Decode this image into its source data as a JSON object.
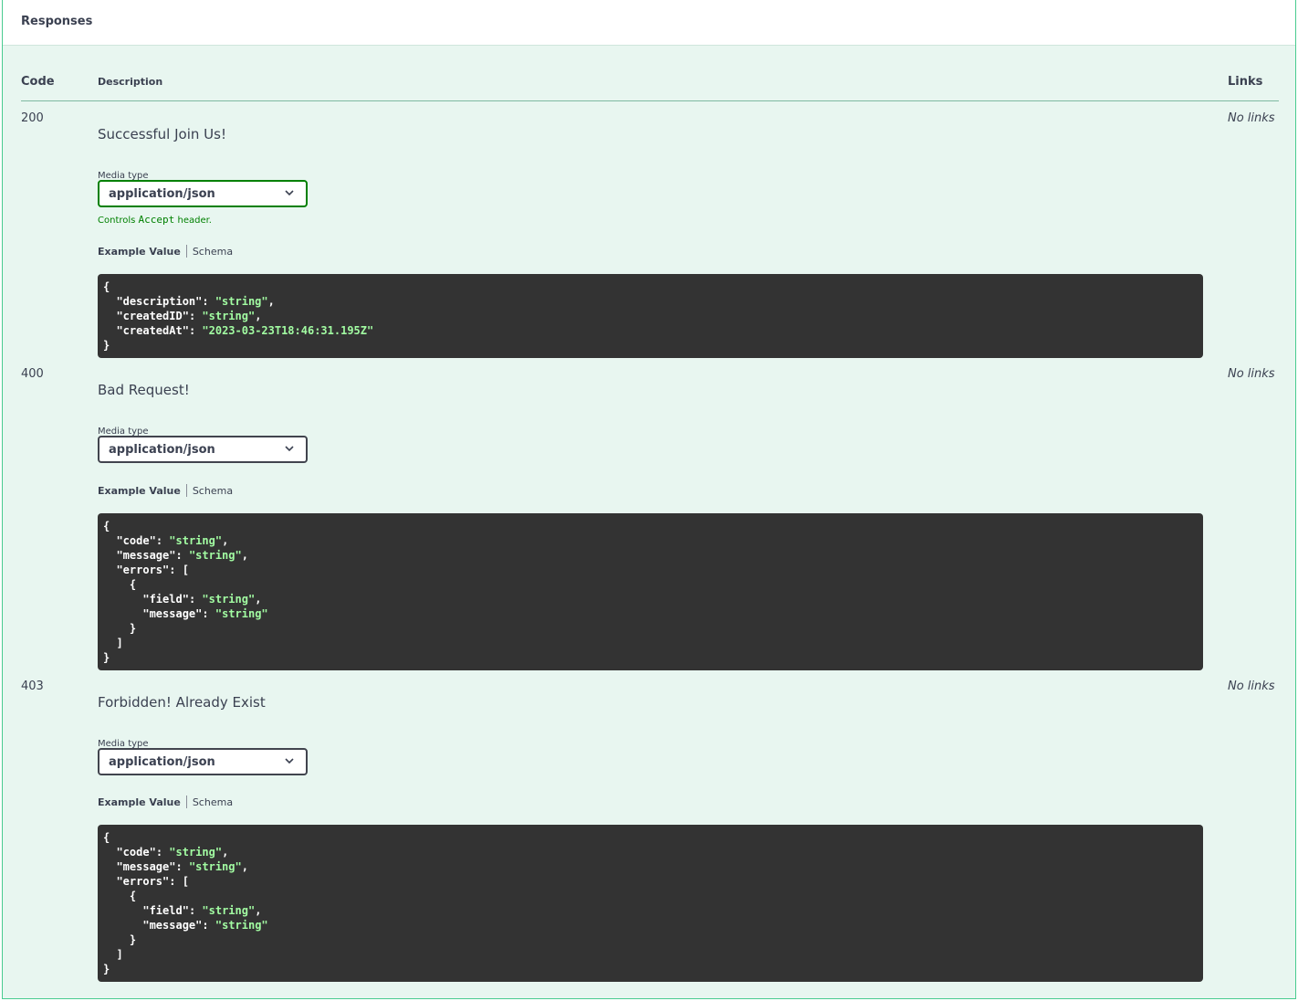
{
  "section": {
    "title": "Responses"
  },
  "columns": {
    "code": "Code",
    "description": "Description",
    "links": "Links"
  },
  "responses": [
    {
      "code": "200",
      "description": "Successful Join Us!",
      "links": "No links",
      "media_type_label": "Media type",
      "media_type": "application/json",
      "controls_prefix": "Controls",
      "controls_header": "Accept",
      "controls_suffix": "header.",
      "tab_example": "Example Value",
      "tab_schema": "Schema",
      "example_lines": [
        [
          [
            "p",
            "{"
          ]
        ],
        [
          [
            "p",
            "  "
          ],
          [
            "k",
            "\"description\""
          ],
          [
            "p",
            ": "
          ],
          [
            "s",
            "\"string\""
          ],
          [
            "p",
            ","
          ]
        ],
        [
          [
            "p",
            "  "
          ],
          [
            "k",
            "\"createdID\""
          ],
          [
            "p",
            ": "
          ],
          [
            "s",
            "\"string\""
          ],
          [
            "p",
            ","
          ]
        ],
        [
          [
            "p",
            "  "
          ],
          [
            "k",
            "\"createdAt\""
          ],
          [
            "p",
            ": "
          ],
          [
            "s",
            "\"2023-03-23T18:46:31.195Z\""
          ]
        ],
        [
          [
            "p",
            "}"
          ]
        ]
      ]
    },
    {
      "code": "400",
      "description": "Bad Request!",
      "links": "No links",
      "media_type_label": "Media type",
      "media_type": "application/json",
      "tab_example": "Example Value",
      "tab_schema": "Schema",
      "example_lines": [
        [
          [
            "p",
            "{"
          ]
        ],
        [
          [
            "p",
            "  "
          ],
          [
            "k",
            "\"code\""
          ],
          [
            "p",
            ": "
          ],
          [
            "s",
            "\"string\""
          ],
          [
            "p",
            ","
          ]
        ],
        [
          [
            "p",
            "  "
          ],
          [
            "k",
            "\"message\""
          ],
          [
            "p",
            ": "
          ],
          [
            "s",
            "\"string\""
          ],
          [
            "p",
            ","
          ]
        ],
        [
          [
            "p",
            "  "
          ],
          [
            "k",
            "\"errors\""
          ],
          [
            "p",
            ": ["
          ]
        ],
        [
          [
            "p",
            "    {"
          ]
        ],
        [
          [
            "p",
            "      "
          ],
          [
            "k",
            "\"field\""
          ],
          [
            "p",
            ": "
          ],
          [
            "s",
            "\"string\""
          ],
          [
            "p",
            ","
          ]
        ],
        [
          [
            "p",
            "      "
          ],
          [
            "k",
            "\"message\""
          ],
          [
            "p",
            ": "
          ],
          [
            "s",
            "\"string\""
          ]
        ],
        [
          [
            "p",
            "    }"
          ]
        ],
        [
          [
            "p",
            "  ]"
          ]
        ],
        [
          [
            "p",
            "}"
          ]
        ]
      ]
    },
    {
      "code": "403",
      "description": "Forbidden! Already Exist",
      "links": "No links",
      "media_type_label": "Media type",
      "media_type": "application/json",
      "tab_example": "Example Value",
      "tab_schema": "Schema",
      "example_lines": [
        [
          [
            "p",
            "{"
          ]
        ],
        [
          [
            "p",
            "  "
          ],
          [
            "k",
            "\"code\""
          ],
          [
            "p",
            ": "
          ],
          [
            "s",
            "\"string\""
          ],
          [
            "p",
            ","
          ]
        ],
        [
          [
            "p",
            "  "
          ],
          [
            "k",
            "\"message\""
          ],
          [
            "p",
            ": "
          ],
          [
            "s",
            "\"string\""
          ],
          [
            "p",
            ","
          ]
        ],
        [
          [
            "p",
            "  "
          ],
          [
            "k",
            "\"errors\""
          ],
          [
            "p",
            ": ["
          ]
        ],
        [
          [
            "p",
            "    {"
          ]
        ],
        [
          [
            "p",
            "      "
          ],
          [
            "k",
            "\"field\""
          ],
          [
            "p",
            ": "
          ],
          [
            "s",
            "\"string\""
          ],
          [
            "p",
            ","
          ]
        ],
        [
          [
            "p",
            "      "
          ],
          [
            "k",
            "\"message\""
          ],
          [
            "p",
            ": "
          ],
          [
            "s",
            "\"string\""
          ]
        ],
        [
          [
            "p",
            "    }"
          ]
        ],
        [
          [
            "p",
            "  ]"
          ]
        ],
        [
          [
            "p",
            "}"
          ]
        ]
      ]
    }
  ],
  "colors": {
    "panel_bg": "#e8f6f0",
    "border": "#49cc90",
    "code_bg": "#333333",
    "string": "#a2fca2",
    "accent_select": "#008000"
  },
  "icons": {
    "select_chevron": "chevron-down-icon"
  }
}
